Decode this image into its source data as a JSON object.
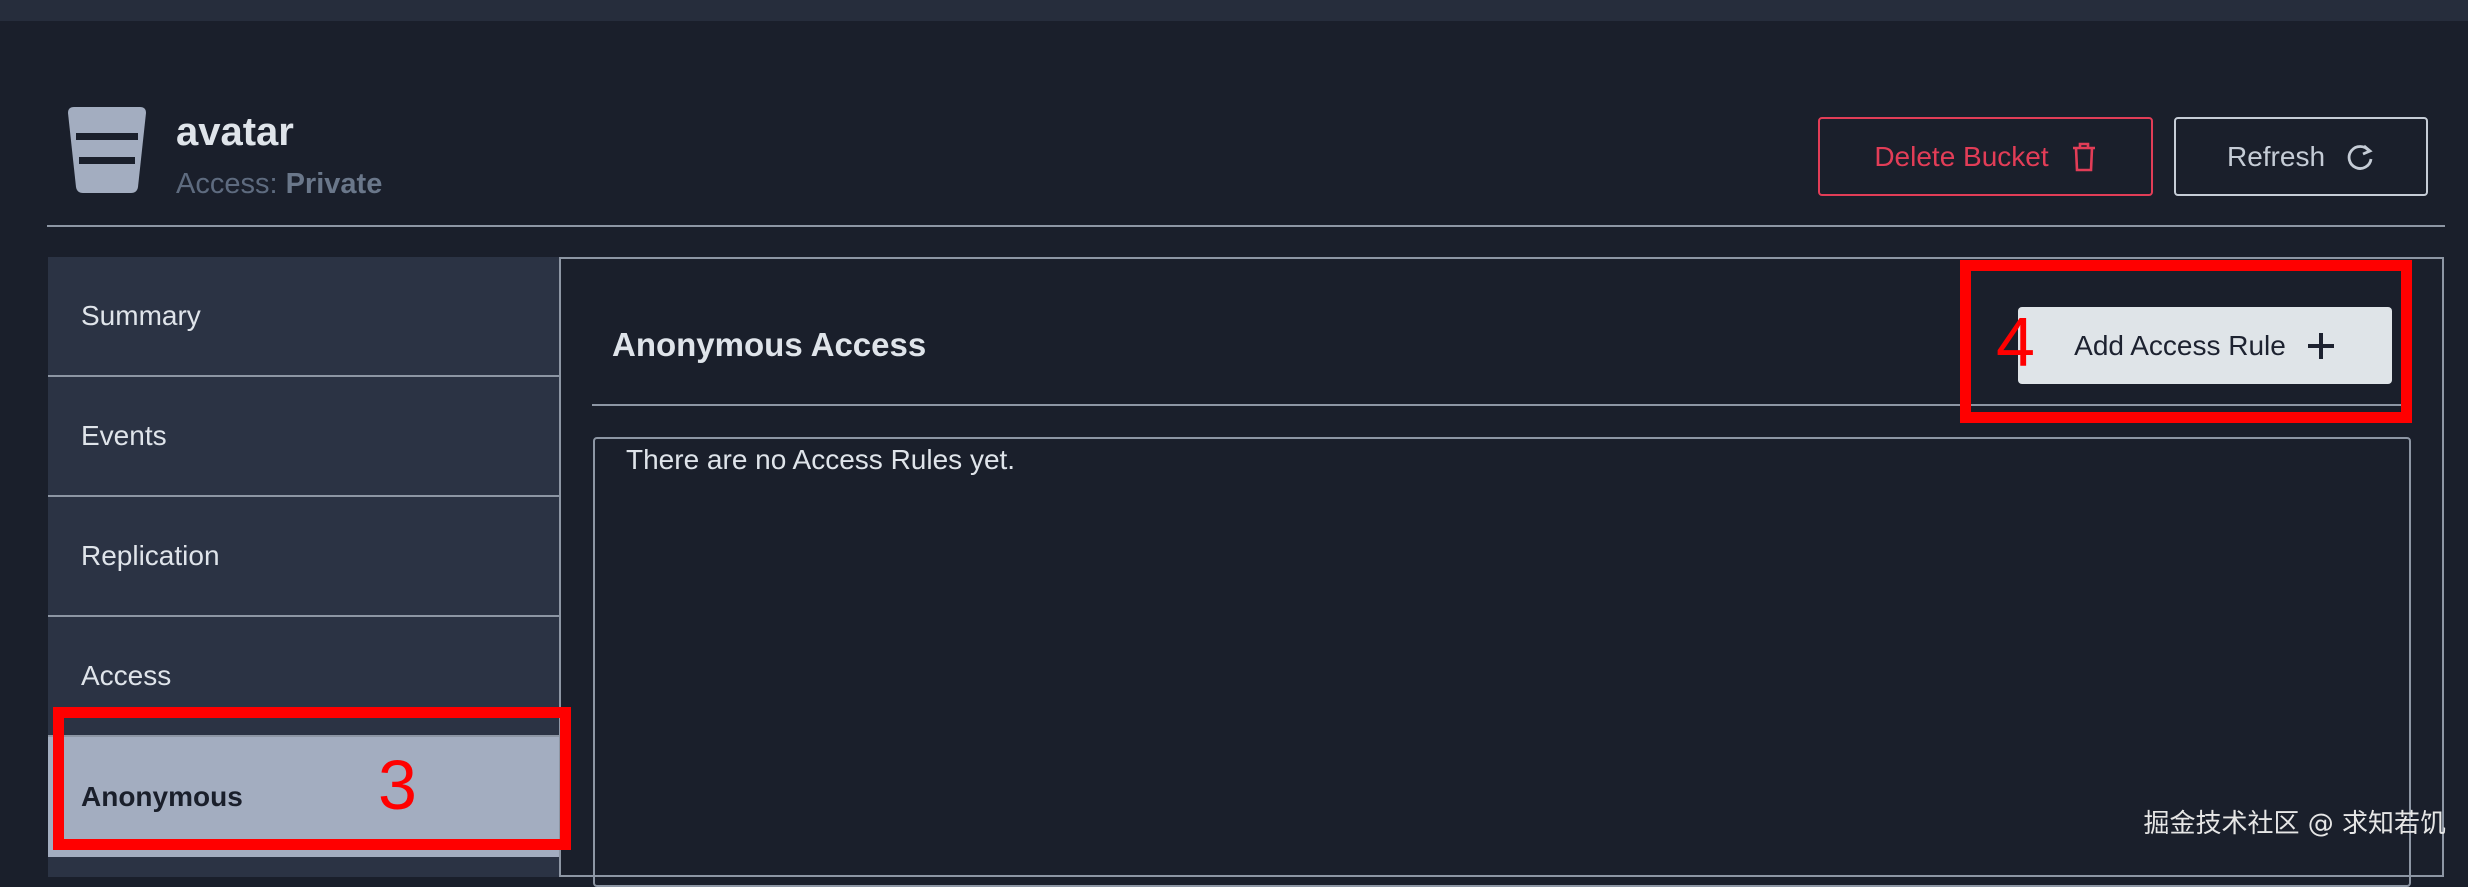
{
  "bucket": {
    "name": "avatar",
    "access_label": "Access:",
    "access_value": "Private"
  },
  "toolbar": {
    "delete_label": "Delete Bucket",
    "refresh_label": "Refresh"
  },
  "sidebar": {
    "items": [
      {
        "label": "Summary"
      },
      {
        "label": "Events"
      },
      {
        "label": "Replication"
      },
      {
        "label": "Access"
      },
      {
        "label": "Anonymous"
      }
    ],
    "active_index": 4
  },
  "content": {
    "title": "Anonymous Access",
    "add_rule_label": "Add Access Rule",
    "empty_message": "There are no Access Rules yet."
  },
  "annotations": {
    "step_3": "3",
    "step_4": "4"
  },
  "watermark": "掘金技术社区 @ 求知若饥",
  "colors": {
    "background": "#1a1f2b",
    "sidebar": "#2b3344",
    "active_nav": "#a3adc0",
    "danger": "#e23d57",
    "annotation": "#ff0000"
  },
  "icons": [
    "bucket-icon",
    "trash-icon",
    "refresh-icon",
    "plus-icon"
  ]
}
